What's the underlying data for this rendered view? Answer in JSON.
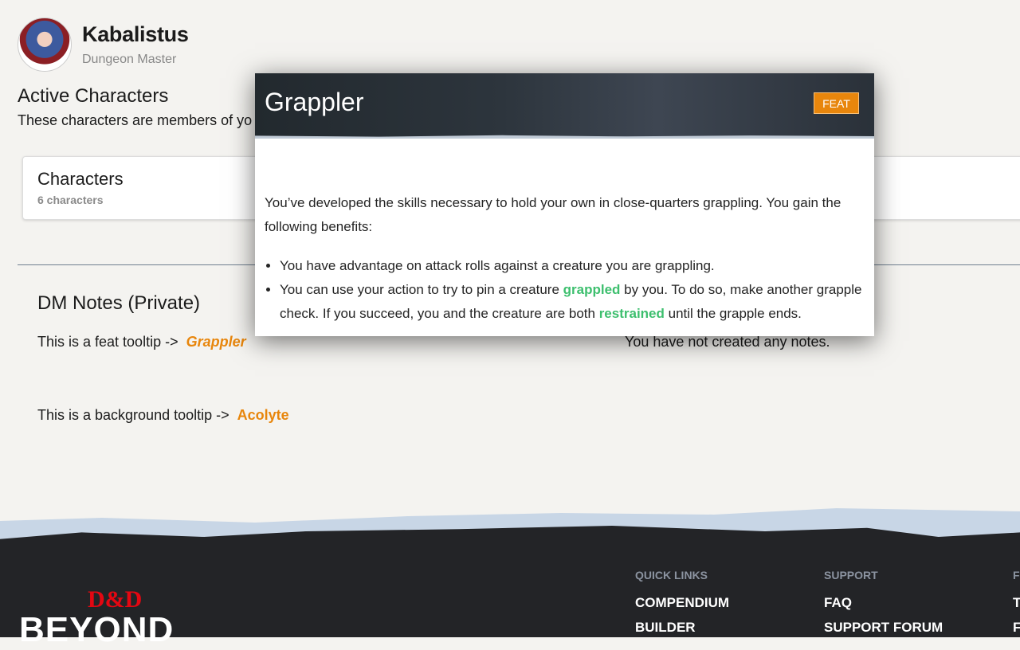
{
  "user": {
    "name": "Kabalistus",
    "role": "Dungeon Master"
  },
  "active": {
    "title": "Active Characters",
    "subtitle": "These characters are members of yo"
  },
  "card": {
    "title": "Characters",
    "count": "6 characters"
  },
  "notes": {
    "title": "DM Notes (Private)",
    "feat_text": "This is a feat tooltip ->",
    "feat_link": "Grappler",
    "bg_text": "This is a background tooltip ->",
    "bg_link": "Acolyte",
    "empty": "You have not created any notes."
  },
  "popup": {
    "title": "Grappler",
    "badge": "FEAT",
    "intro": "You’ve developed the skills necessary to hold your own in close-quarters grappling. You gain the following benefits:",
    "b1": "You have advantage on attack rolls against a creature you are grappling.",
    "b2a": "You can use your action to try to pin a creature ",
    "b2k1": "grappled",
    "b2b": " by you. To do so, make another grapple check. If you succeed, you and the creature are both ",
    "b2k2": "restrained",
    "b2c": " until the grapple ends."
  },
  "footer": {
    "logo_top": "D&D",
    "logo_bottom": "BEYOND",
    "cols": [
      {
        "heading": "QUICK LINKS",
        "links": [
          "COMPENDIUM",
          "BUILDER"
        ]
      },
      {
        "heading": "SUPPORT",
        "links": [
          "FAQ",
          "SUPPORT FORUM"
        ]
      },
      {
        "heading": "F",
        "links": [
          "T",
          "F"
        ]
      }
    ]
  },
  "colors": {
    "accent": "#e8860c",
    "keyword": "#3dbf6e",
    "footer_bg": "#232427"
  }
}
